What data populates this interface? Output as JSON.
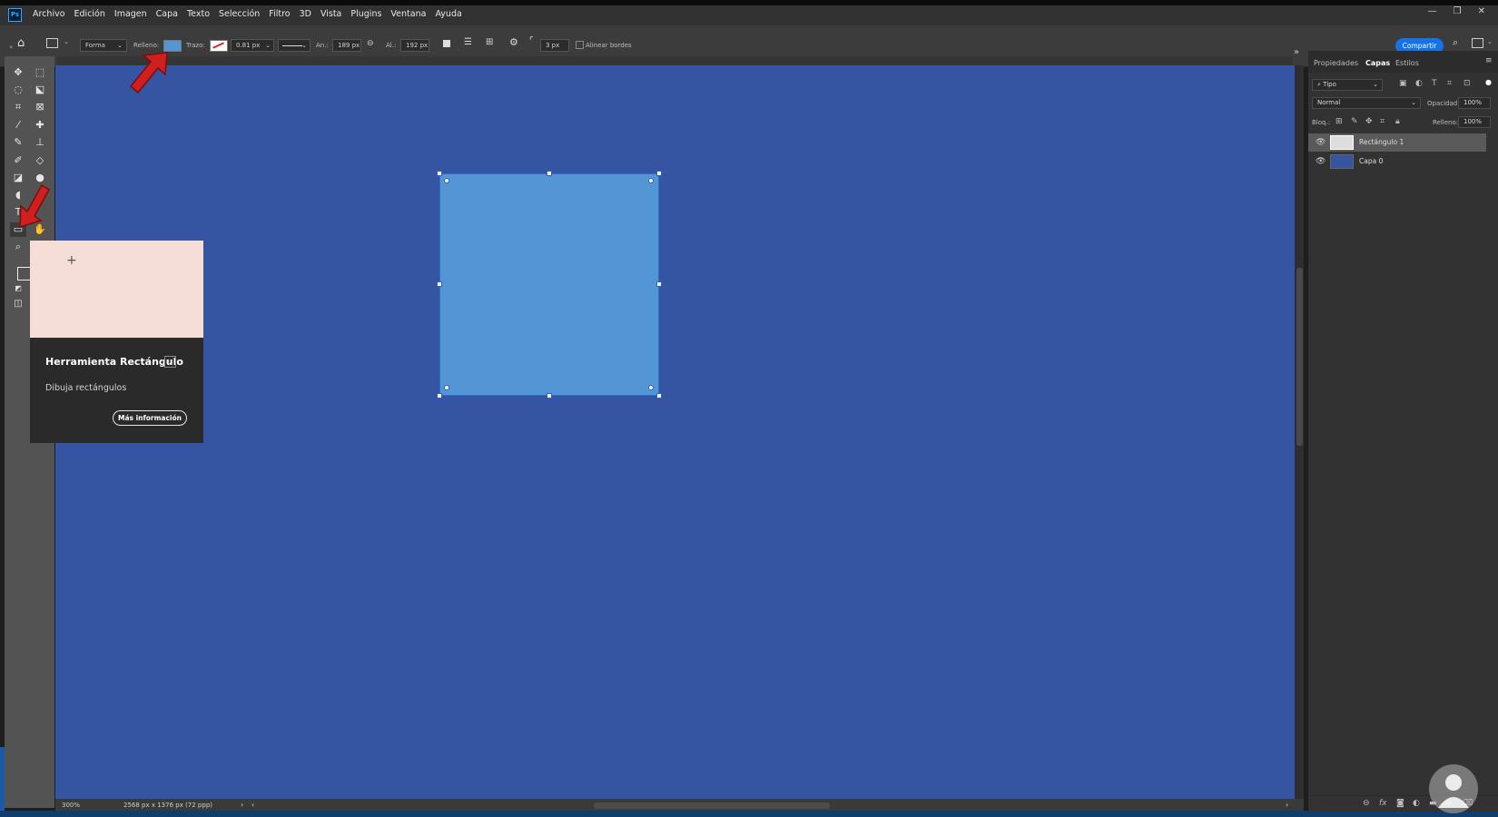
{
  "app": {
    "logo": "Ps"
  },
  "menu": [
    "Archivo",
    "Edición",
    "Imagen",
    "Capa",
    "Texto",
    "Selección",
    "Filtro",
    "3D",
    "Vista",
    "Plugins",
    "Ventana",
    "Ayuda"
  ],
  "window_controls": {
    "minimize": "—",
    "restore": "❐",
    "close": "✕"
  },
  "options": {
    "mode": "Forma",
    "fill_label": "Relleno:",
    "fill_color": "#5496d5",
    "stroke_label": "Trazo:",
    "stroke_width": "0.81 px",
    "width_label": "An.:",
    "width_value": "189 px",
    "height_label": "Al.:",
    "height_value": "192 px",
    "radius_value": "3 px",
    "align_edges": "Alinear bordes",
    "share": "Compartir"
  },
  "tooltip": {
    "title": "Herramienta Rectángulo",
    "shortcut": "U",
    "description": "Dibuja rectángulos",
    "button": "Más información"
  },
  "status": {
    "zoom": "300%",
    "doc_info": "2568 px x 1376 px (72 ppp)"
  },
  "panel": {
    "tabs": [
      "Propiedades",
      "Capas",
      "Estilos"
    ],
    "active_tab": "Capas",
    "filter": "Tipo",
    "blend_mode": "Normal",
    "opacity_label": "Opacidad:",
    "opacity": "100%",
    "lock_label": "Bloq.:",
    "fill_label": "Relleno:",
    "fill": "100%",
    "layers": [
      {
        "name": "Rectángulo 1",
        "selected": true
      },
      {
        "name": "Capa 0",
        "selected": false
      }
    ]
  },
  "colors": {
    "canvas": "#3555a2",
    "shape": "#5496d5",
    "accent": "#1473e6",
    "tooltip_preview": "#f5ddd8"
  }
}
